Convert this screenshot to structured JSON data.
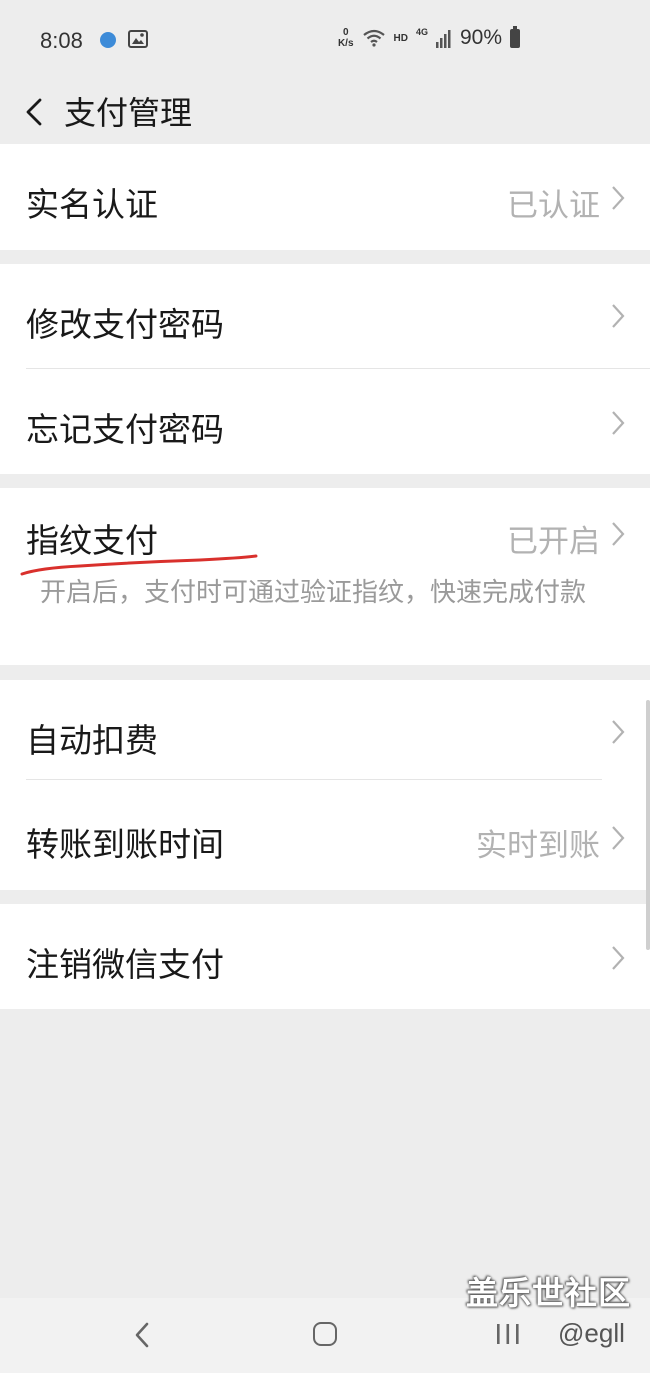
{
  "status_bar": {
    "time": "8:08",
    "speed_value": "0",
    "speed_unit": "K/s",
    "hd_label": "HD",
    "network_label": "4G",
    "battery": "90%"
  },
  "header": {
    "title": "支付管理"
  },
  "groups": [
    {
      "items": [
        {
          "label": "实名认证",
          "value": "已认证"
        }
      ]
    },
    {
      "items": [
        {
          "label": "修改支付密码",
          "value": ""
        },
        {
          "label": "忘记支付密码",
          "value": ""
        }
      ]
    },
    {
      "items": [
        {
          "label": "指纹支付",
          "value": "已开启",
          "description": "开启后，支付时可通过验证指纹，快速完成付款"
        }
      ]
    },
    {
      "items": [
        {
          "label": "自动扣费",
          "value": ""
        },
        {
          "label": "转账到账时间",
          "value": "实时到账"
        }
      ]
    },
    {
      "items": [
        {
          "label": "注销微信支付",
          "value": ""
        }
      ]
    }
  ],
  "watermark": {
    "title": "盖乐世社区",
    "user": "@egll"
  },
  "colors": {
    "background": "#ededed",
    "card": "#ffffff",
    "primary_text": "#191919",
    "secondary_text": "#b2b2b2",
    "annotation_red": "#d9302c"
  }
}
